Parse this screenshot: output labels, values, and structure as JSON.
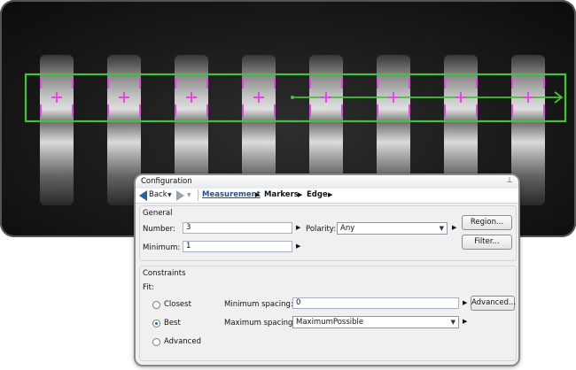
{
  "camera": {
    "markers_count": 8,
    "roi_color": "#45c23c",
    "marker_color": "#e04ce0"
  },
  "config": {
    "title": "Configuration",
    "toolbar": {
      "back_label": "Back"
    },
    "breadcrumb": [
      "Measurement",
      "Markers",
      "Edge"
    ],
    "general": {
      "header": "General",
      "number_label": "Number:",
      "number_value": "3",
      "minimum_label": "Minimum:",
      "minimum_value": "1",
      "polarity_label": "Polarity:",
      "polarity_value": "Any",
      "region_button": "Region...",
      "filter_button": "Filter..."
    },
    "constraints": {
      "header": "Constraints",
      "fit_label": "Fit:",
      "options": [
        "Closest",
        "Best",
        "Advanced"
      ],
      "selected": "Best",
      "min_spacing_label": "Minimum spacing:",
      "min_spacing_value": "0",
      "max_spacing_label": "Maximum spacing:",
      "max_spacing_value": "MaximumPossible",
      "advanced_button": "Advanced..."
    }
  }
}
